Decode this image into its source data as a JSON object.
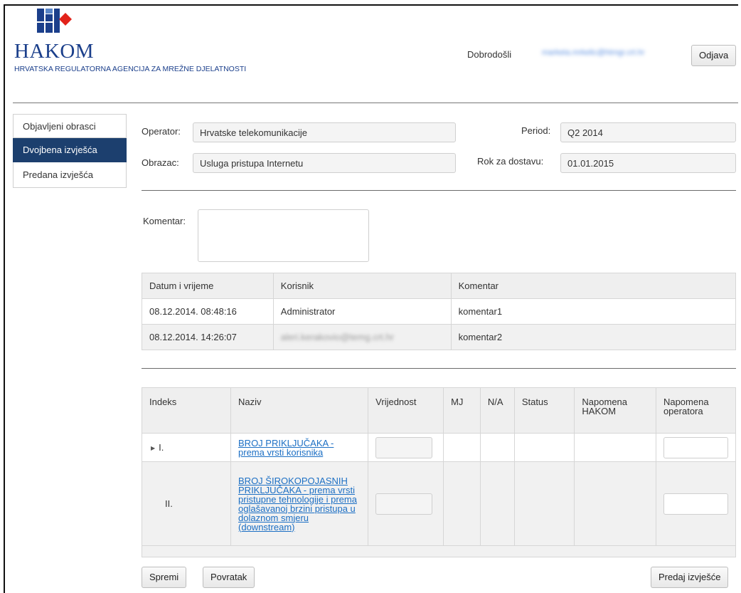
{
  "header": {
    "logo_word": "HAKOM",
    "logo_subtitle": "HRVATSKA REGULATORNA AGENCIJA ZA MREŽNE DJELATNOSTI",
    "welcome_label": "Dobrodošli",
    "user_email": "marketa.mrkelic@htmgr.crt.hr",
    "logout_label": "Odjava"
  },
  "sidebar": {
    "items": [
      {
        "label": "Objavljeni obrasci",
        "active": false
      },
      {
        "label": "Dvojbena izvješća",
        "active": true
      },
      {
        "label": "Predana izvješća",
        "active": false
      }
    ]
  },
  "form": {
    "operator_label": "Operator:",
    "operator_value": "Hrvatske telekomunikacije",
    "obrazac_label": "Obrazac:",
    "obrazac_value": "Usluga pristupa Internetu",
    "period_label": "Period:",
    "period_value": "Q2 2014",
    "rok_label": "Rok za dostavu:",
    "rok_value": "01.01.2015",
    "komentar_label": "Komentar:"
  },
  "comments_table": {
    "headers": [
      "Datum i vrijeme",
      "Korisnik",
      "Komentar"
    ],
    "rows": [
      {
        "datetime": "08.12.2014. 08:48:16",
        "user": "Administrator",
        "comment": "komentar1"
      },
      {
        "datetime": "08.12.2014. 14:26:07",
        "user": "aleri.kerakovio@temg.crt.hr",
        "comment": "komentar2"
      }
    ]
  },
  "index_table": {
    "headers": [
      "Indeks",
      "Naziv",
      "Vrijednost",
      "MJ",
      "N/A",
      "Status",
      "Napomena HAKOM",
      "Napomena operatora"
    ],
    "rows": [
      {
        "index": "I.",
        "name": "BROJ PRIKLJUČAKA - prema vrsti korisnika"
      },
      {
        "index": "II.",
        "name": "BROJ ŠIROKOPOJASNIH PRIKLJUČAKA - prema vrsti pristupne tehnologije i prema oglašavanoj brzini pristupa u dolaznom smjeru (downstream)"
      }
    ]
  },
  "actions": {
    "save_label": "Spremi",
    "back_label": "Povratak",
    "submit_label": "Predaj izvješće"
  },
  "colors": {
    "brand": "#1b3f8b",
    "active_nav": "#1c3f6e",
    "link": "#1c6fc4",
    "logo_red": "#e2231a"
  }
}
